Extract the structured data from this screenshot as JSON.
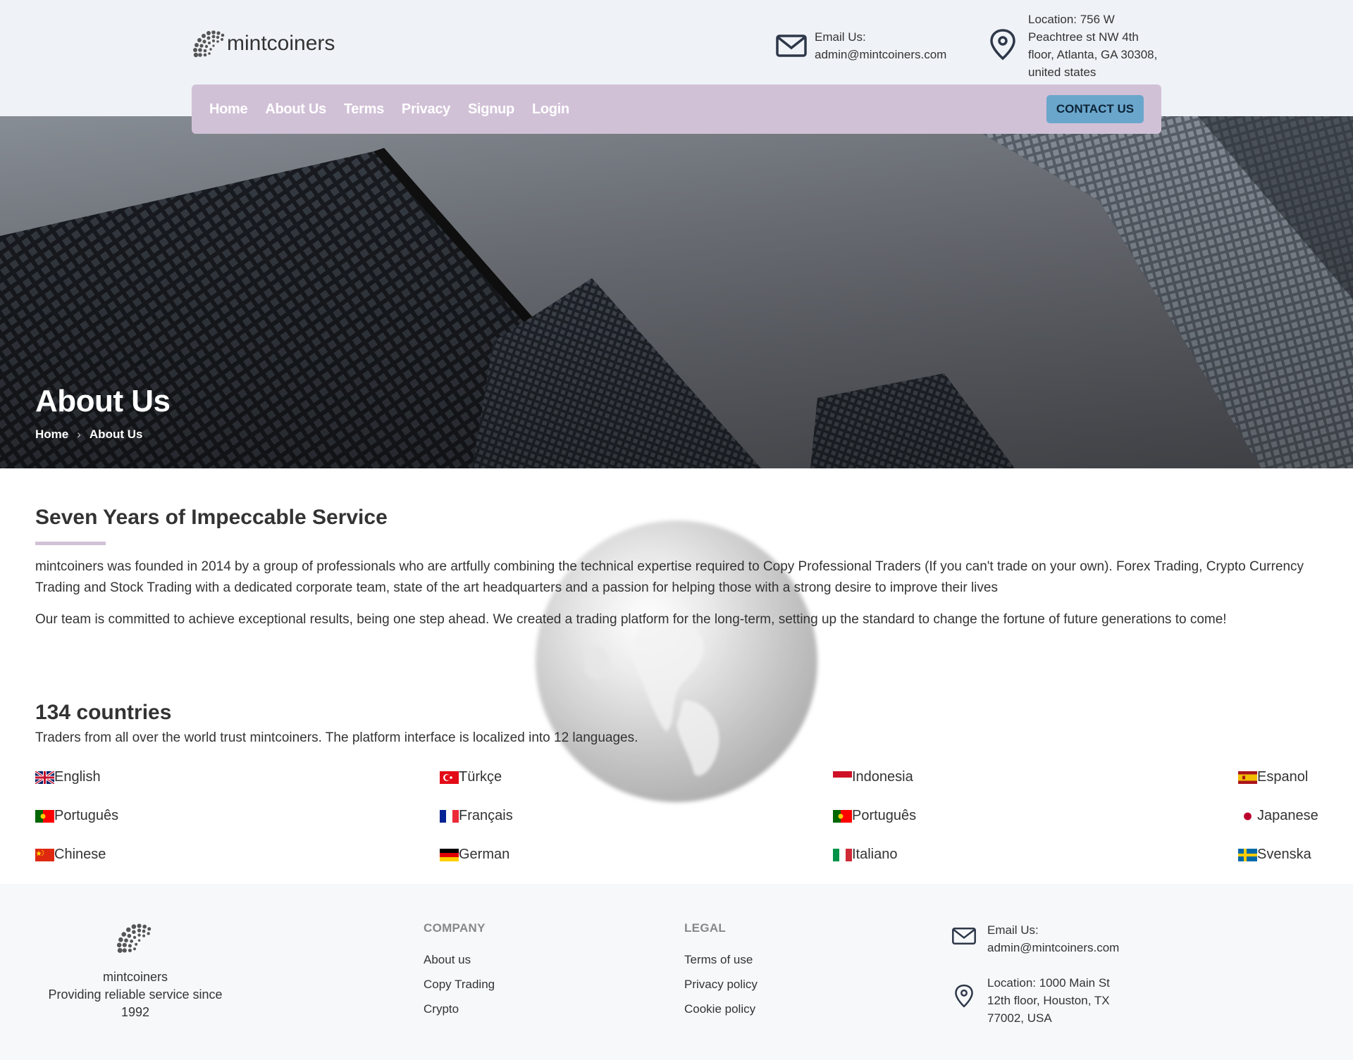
{
  "header": {
    "brand": "mintcoiners",
    "email_label": "Email Us:",
    "email": "admin@mintcoiners.com",
    "location_lines": [
      "Location: 756 W",
      "Peachtree st NW 4th",
      "floor, Atlanta, GA 30308,",
      "united states"
    ]
  },
  "nav": {
    "items": [
      "Home",
      "About Us",
      "Terms",
      "Privacy",
      "Signup",
      "Login"
    ],
    "contact_button": "CONTACT US"
  },
  "hero": {
    "title": "About Us",
    "breadcrumb": [
      "Home",
      "About Us"
    ]
  },
  "about": {
    "title": "Seven Years of Impeccable Service",
    "paragraph1": "mintcoiners was founded in 2014 by a group of professionals who are artfully combining the technical expertise required to Copy Professional Traders (If you can't trade on your own). Forex Trading, Crypto Currency Trading and Stock Trading with a dedicated corporate team, state of the art headquarters and a passion for helping those with a strong desire to improve their lives",
    "paragraph2": "Our team is committed to achieve exceptional results, being one step ahead. We created a trading platform for the long-term, setting up the standard to change the fortune of future generations to come!",
    "countries_title": "134 countries",
    "countries_sub": "Traders from all over the world trust mintcoiners. The platform interface is localized into 12 languages."
  },
  "languages": [
    {
      "label": "English",
      "flag": "uk-flag-icon"
    },
    {
      "label": "Türkçe",
      "flag": "turkey-flag-icon"
    },
    {
      "label": "Indonesia",
      "flag": "indonesia-flag-icon"
    },
    {
      "label": "Espanol",
      "flag": "spain-flag-icon"
    },
    {
      "label": "Português",
      "flag": "portugal-flag-icon"
    },
    {
      "label": "Français",
      "flag": "france-flag-icon"
    },
    {
      "label": "Português",
      "flag": "portugal-flag-icon"
    },
    {
      "label": "Japanese",
      "flag": "japan-flag-icon"
    },
    {
      "label": "Chinese",
      "flag": "china-flag-icon"
    },
    {
      "label": "German",
      "flag": "germany-flag-icon"
    },
    {
      "label": "Italiano",
      "flag": "italy-flag-icon"
    },
    {
      "label": "Svenska",
      "flag": "sweden-flag-icon"
    }
  ],
  "footer": {
    "brand": "mintcoiners",
    "tagline": "Providing reliable service since 1992",
    "company_title": "COMPANY",
    "company_links": [
      "About us",
      "Copy Trading",
      "Crypto"
    ],
    "legal_title": "LEGAL",
    "legal_links": [
      "Terms of use",
      "Privacy policy",
      "Cookie policy"
    ],
    "email_label": "Email Us:",
    "email": "admin@mintcoiners.com",
    "location_lines": [
      "Location: 1000 Main St",
      "12th floor, Houston, TX",
      "77002, USA"
    ]
  },
  "colors": {
    "nav_bg": "#d1c1d7",
    "contact_button_bg": "#6aa6cc",
    "header_bg": "#eff2f7",
    "footer_bg": "#f7f8fa"
  }
}
